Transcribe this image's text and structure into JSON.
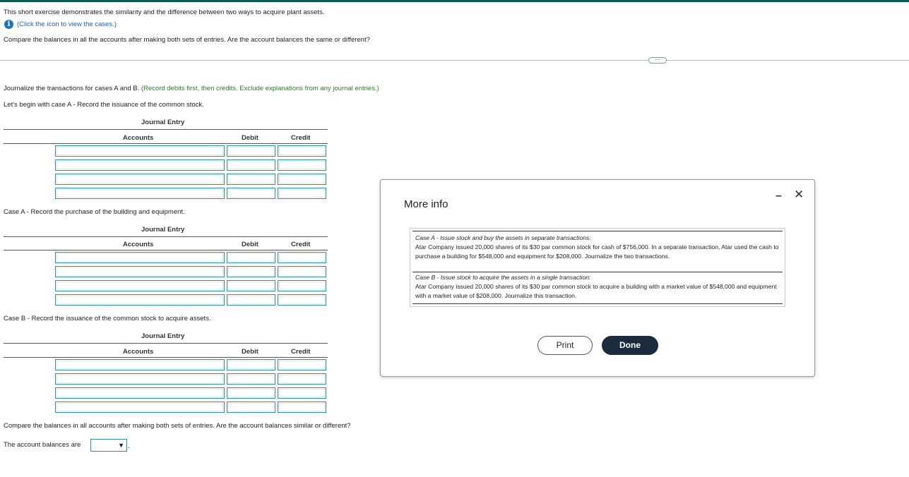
{
  "intro": {
    "line1": "This short exercise demonstrates the similarity and the difference between two ways to acquire plant assets.",
    "info_link": "(Click the icon to view the cases.)",
    "line3": "Compare the balances in all the accounts after making both sets of entries. Are the account balances the same or different?"
  },
  "instructions": {
    "main": "Journalize the transactions for cases A and B.",
    "note": "(Record debits first, then credits. Exclude explanations from any journal entries.)",
    "case_a_issue": "Let's begin with case A - Record the issuance of the common stock.",
    "case_a_purchase": "Case A - Record the purchase of the building and equipment.",
    "case_b_issue": "Case B - Record the issuance of the common stock to acquire assets."
  },
  "journal": {
    "title": "Journal Entry",
    "col_accounts": "Accounts",
    "col_debit": "Debit",
    "col_credit": "Credit"
  },
  "compare": {
    "question": "Compare the balances in all accounts after making both sets of entries. Are the account balances similar or different?",
    "answer_label": "The account balances are",
    "answer_value": "",
    "period": "."
  },
  "modal": {
    "title": "More info",
    "case_a_heading": "Case A - Issue stock and buy the assets in separate transactions:",
    "case_a_text": "Atar Company issued 20,000 shares of its $30 par common stock for cash of $756,000. In a separate transaction, Atar used the cash to purchase a building for $548,000 and equipment for $208,000. Journalize the two transactions.",
    "case_b_heading": "Case B - Issue stock to acquire the assets in a single transaction:",
    "case_b_text": "Atar Company issued 20,000 shares of its $30 par common stock to acquire a building with a market value of $548,000 and equipment with a market value of $208,000. Journalize this transaction.",
    "print_label": "Print",
    "done_label": "Done",
    "minimize_symbol": "–",
    "close_symbol": "✕"
  },
  "colors": {
    "top_bar": "#0a5c4e",
    "note_text": "#2a7a2a",
    "info_icon": "#1e73be",
    "cell_border": "#2f8f9d",
    "done_button": "#1c2a3e"
  },
  "icons": {
    "info": "info-icon",
    "expand": "ellipsis-icon",
    "dropdown": "dropdown-arrow-icon",
    "minimize": "minimize-icon",
    "close": "close-icon"
  }
}
